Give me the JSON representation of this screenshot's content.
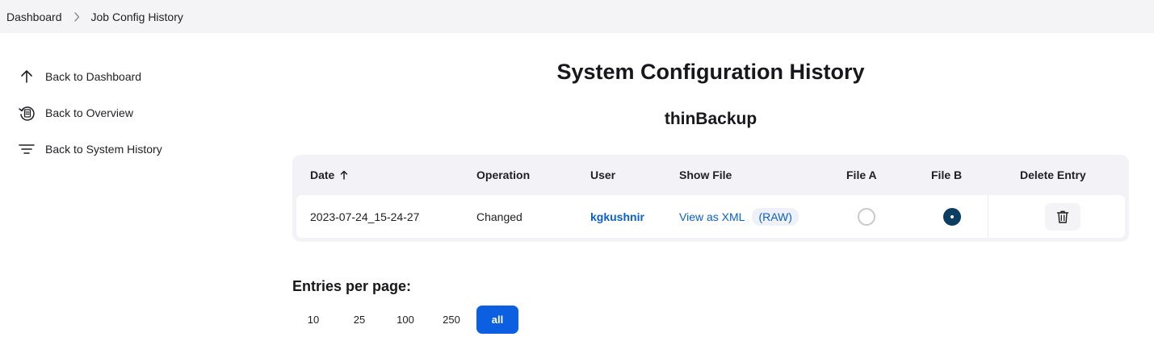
{
  "breadcrumb": {
    "items": [
      "Dashboard",
      "Job Config History"
    ],
    "separator_icon": "chevron-right-icon"
  },
  "sidebar": {
    "items": [
      {
        "label": "Back to Dashboard",
        "icon": "arrow-up-icon"
      },
      {
        "label": "Back to Overview",
        "icon": "history-list-icon"
      },
      {
        "label": "Back to System History",
        "icon": "filter-lines-icon"
      }
    ]
  },
  "main": {
    "title": "System Configuration History",
    "subtitle": "thinBackup"
  },
  "table": {
    "columns": [
      "Date",
      "Operation",
      "User",
      "Show File",
      "File A",
      "File B",
      "Delete Entry"
    ],
    "sort_icon": "arrow-up-icon",
    "rows": [
      {
        "date": "2023-07-24_15-24-27",
        "operation": "Changed",
        "user": "kgkushnir",
        "show_file": "View as XML",
        "raw": "(RAW)",
        "file_a_selected": false,
        "file_b_selected": true,
        "delete_icon": "trash-icon"
      }
    ]
  },
  "pagination": {
    "label": "Entries per page:",
    "options": [
      "10",
      "25",
      "100",
      "250",
      "all"
    ],
    "selected": "all"
  },
  "colors": {
    "link": "#0b5fce",
    "accent": "#0b5fe0",
    "radio_checked": "#0d3d61"
  }
}
